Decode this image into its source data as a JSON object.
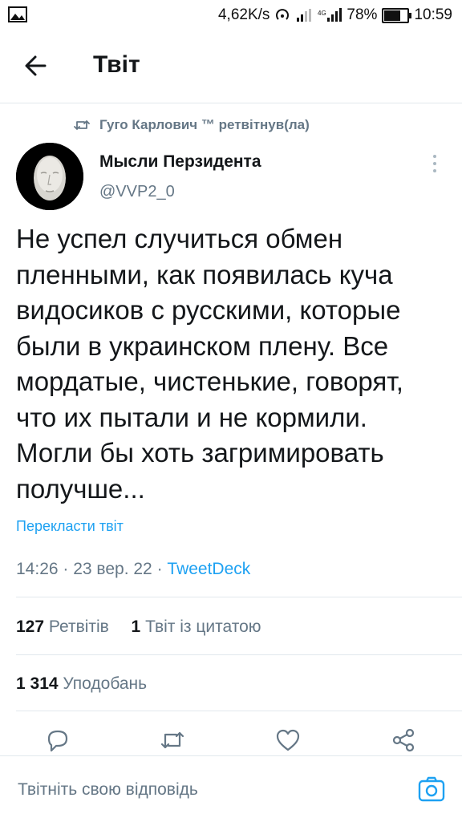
{
  "status_bar": {
    "net_speed": "4,62K/s",
    "battery_text": "78%",
    "battery_level": 0.78,
    "time": "10:59"
  },
  "header": {
    "title": "Твіт"
  },
  "retweet": {
    "text": "Гуго Карлович ™ ретвітнув(ла)"
  },
  "author": {
    "name": "Мысли Перзидента",
    "handle": "@VVP2_0"
  },
  "tweet": {
    "lines": [
      "Не успел случиться обмен",
      "пленными, как появилась куча",
      "видосиков с русскими, которые",
      "были в украинском плену. Все",
      "мордатые, чистенькие, говорят,",
      "что их пытали и не кормили.",
      "Могли бы хоть загримировать",
      "получше..."
    ],
    "translate_label": "Перекласти твіт",
    "time": "14:26",
    "date": "23 вер. 22",
    "source": "TweetDeck"
  },
  "stats": {
    "retweets_count": "127",
    "retweets_label": "Ретвітів",
    "quotes_count": "1",
    "quotes_label": "Твіт із цитатою",
    "likes_count": "1 314",
    "likes_label": "Уподобань"
  },
  "actions": [
    "reply-icon",
    "retweet-icon",
    "like-icon",
    "share-icon"
  ],
  "reply": {
    "placeholder": "Твітніть свою відповідь"
  },
  "colors": {
    "accent": "#1da1f2",
    "secondary_text": "#657786",
    "divider": "#e1e8ed"
  }
}
